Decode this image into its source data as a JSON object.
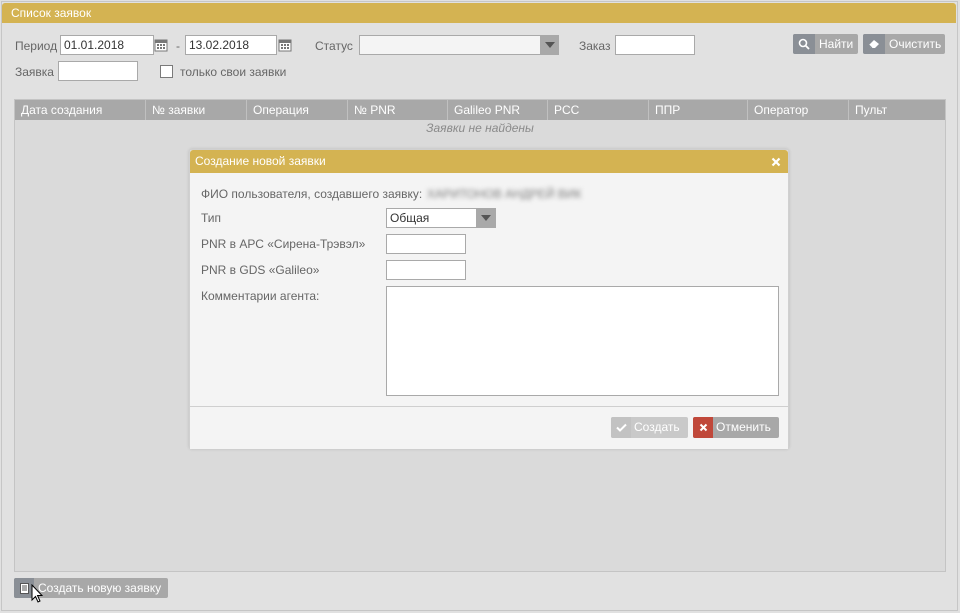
{
  "window": {
    "title": "Список заявок"
  },
  "filters": {
    "period_label": "Период",
    "date_from": "01.01.2018",
    "date_separator": "-",
    "date_to": "13.02.2018",
    "status_label": "Статус",
    "status_value": "",
    "order_label": "Заказ",
    "order_value": "",
    "request_label": "Заявка",
    "request_value": "",
    "only_mine_label": "только свои заявки",
    "find_label": "Найти",
    "clear_label": "Очистить"
  },
  "grid": {
    "columns": [
      "Дата создания",
      "№ заявки",
      "Операция",
      "№ PNR",
      "Galileo PNR",
      "PCC",
      "ППР",
      "Оператор",
      "Пульт"
    ],
    "empty_text": "Заявки не найдены"
  },
  "create_request_label": "Создать новую заявку",
  "modal": {
    "title": "Создание новой заявки",
    "user_label": "ФИО пользователя, создавшего заявку:",
    "user_value": "ХАРИТОНОВ АНДРЕЙ ВИК",
    "type_label": "Тип",
    "type_value": "Общая",
    "pnr_arc_label": "PNR в АРС «Сирена-Трэвэл»",
    "pnr_arc_value": "",
    "pnr_gds_label": "PNR в GDS «Galileo»",
    "pnr_gds_value": "",
    "comment_label": "Комментарии агента:",
    "comment_value": "",
    "create_label": "Создать",
    "cancel_label": "Отменить"
  },
  "colors": {
    "accent": "#d4b352",
    "button_gray": "#a8a8a8",
    "cancel_icon": "#c0483a"
  },
  "icons": [
    "calendar-icon",
    "search-icon",
    "eraser-icon",
    "document-icon",
    "close-icon",
    "check-icon",
    "x-icon",
    "mouse-cursor-icon"
  ]
}
